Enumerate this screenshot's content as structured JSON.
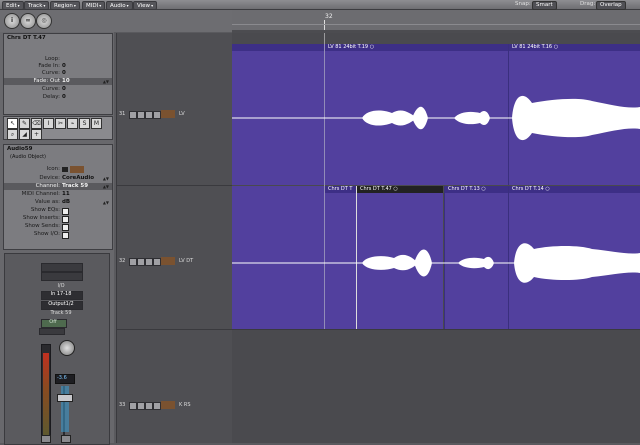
{
  "menubar": {
    "menus": [
      "Edit",
      "Track",
      "Region",
      "MIDI",
      "Audio",
      "View"
    ],
    "snap_label": "Snap:",
    "snap_value": "Smart",
    "drag_label": "Drag:",
    "drag_value": "Overlap"
  },
  "ruler": {
    "marker": "32"
  },
  "region_panel": {
    "title": "Chrs DT T.47",
    "rows": [
      {
        "label": "Loop:",
        "value": ""
      },
      {
        "label": "Fade In:",
        "value": "0"
      },
      {
        "label": "Curve:",
        "value": "0"
      },
      {
        "label": "Fade: Out",
        "value": "10"
      },
      {
        "label": "Curve:",
        "value": "0"
      },
      {
        "label": "Delay:",
        "value": "0"
      }
    ]
  },
  "track_panel": {
    "title": "Audio59",
    "subtitle": "(Audio Object)",
    "rows": [
      {
        "label": "Icon:",
        "value": ""
      },
      {
        "label": "Device:",
        "value": "CoreAudio"
      },
      {
        "label": "Channel:",
        "value": "Track 59"
      },
      {
        "label": "MIDI Channel:",
        "value": "11"
      },
      {
        "label": "Value as:",
        "value": "dB"
      },
      {
        "label": "Show EQs:",
        "value": ""
      },
      {
        "label": "Show Inserts:",
        "value": ""
      },
      {
        "label": "Show Sends:",
        "value": ""
      },
      {
        "label": "Show I/O:",
        "value": ""
      }
    ]
  },
  "channel_strip": {
    "io": "I/O",
    "input": "In 17-18",
    "output": "Output1/2",
    "track": "Track 59",
    "off": "Off",
    "volume": "-3.6"
  },
  "tracks": [
    {
      "num": "31",
      "name": "LV"
    },
    {
      "num": "32",
      "name": "LV DT"
    },
    {
      "num": "33",
      "name": "K RS"
    }
  ],
  "regions": {
    "track1": [
      "LV 81 24bit T.19",
      "LV 81 24bit T.16"
    ],
    "track2": [
      "Chrs DT T",
      "Chrs DT T.47",
      "Chrs DT T.13",
      "Chrs DT T.14"
    ]
  },
  "colors": {
    "region": "#52409e",
    "region_header": "#3d2f86",
    "waveform": "#ffffff"
  }
}
